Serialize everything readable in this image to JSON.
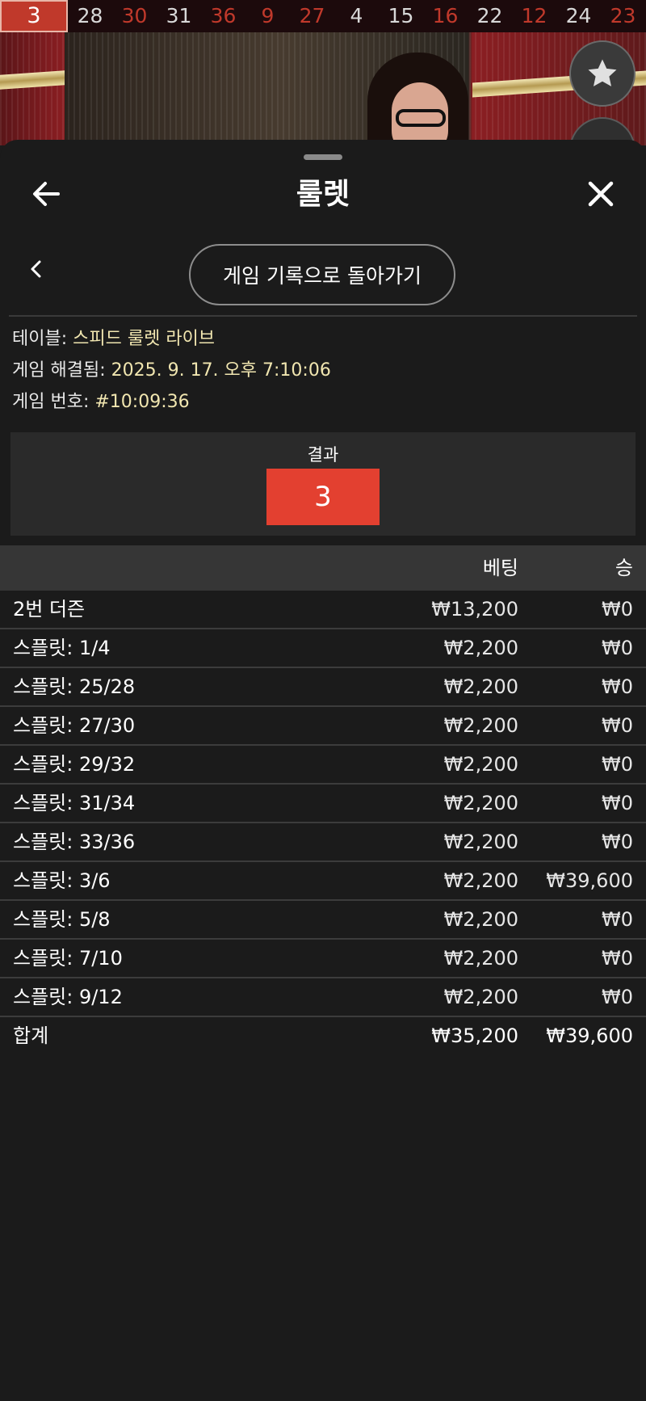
{
  "history": [
    {
      "n": "3",
      "color": "red"
    },
    {
      "n": "28",
      "color": "black"
    },
    {
      "n": "30",
      "color": "red"
    },
    {
      "n": "31",
      "color": "black"
    },
    {
      "n": "36",
      "color": "red"
    },
    {
      "n": "9",
      "color": "red"
    },
    {
      "n": "27",
      "color": "red"
    },
    {
      "n": "4",
      "color": "black"
    },
    {
      "n": "15",
      "color": "black"
    },
    {
      "n": "16",
      "color": "red"
    },
    {
      "n": "22",
      "color": "black"
    },
    {
      "n": "12",
      "color": "red"
    },
    {
      "n": "24",
      "color": "black"
    },
    {
      "n": "23",
      "color": "red"
    }
  ],
  "header": {
    "title": "룰렛"
  },
  "nav": {
    "return_label": "게임 기록으로 돌아가기"
  },
  "info": {
    "table_label": "테이블: ",
    "table_value": "스피드 룰렛 라이브",
    "resolved_label": "게임 해결됨: ",
    "resolved_value": "2025. 9. 17. 오후 7:10:06",
    "game_no_label": "게임 번호: ",
    "game_no_value": "#10:09:36"
  },
  "result": {
    "label": "결과",
    "number": "3"
  },
  "table": {
    "col_bet": "베팅",
    "col_win": "승",
    "rows": [
      {
        "name": "2번 더즌",
        "bet": "₩13,200",
        "win": "₩0"
      },
      {
        "name": "스플릿: 1/4",
        "bet": "₩2,200",
        "win": "₩0"
      },
      {
        "name": "스플릿: 25/28",
        "bet": "₩2,200",
        "win": "₩0"
      },
      {
        "name": "스플릿: 27/30",
        "bet": "₩2,200",
        "win": "₩0"
      },
      {
        "name": "스플릿: 29/32",
        "bet": "₩2,200",
        "win": "₩0"
      },
      {
        "name": "스플릿: 31/34",
        "bet": "₩2,200",
        "win": "₩0"
      },
      {
        "name": "스플릿: 33/36",
        "bet": "₩2,200",
        "win": "₩0"
      },
      {
        "name": "스플릿: 3/6",
        "bet": "₩2,200",
        "win": "₩39,600"
      },
      {
        "name": "스플릿: 5/8",
        "bet": "₩2,200",
        "win": "₩0"
      },
      {
        "name": "스플릿: 7/10",
        "bet": "₩2,200",
        "win": "₩0"
      },
      {
        "name": "스플릿: 9/12",
        "bet": "₩2,200",
        "win": "₩0"
      }
    ],
    "total": {
      "name": "합계",
      "bet": "₩35,200",
      "win": "₩39,600"
    }
  },
  "colors": {
    "accent_red": "#e34030",
    "value_yellow": "#f1e6b0"
  }
}
